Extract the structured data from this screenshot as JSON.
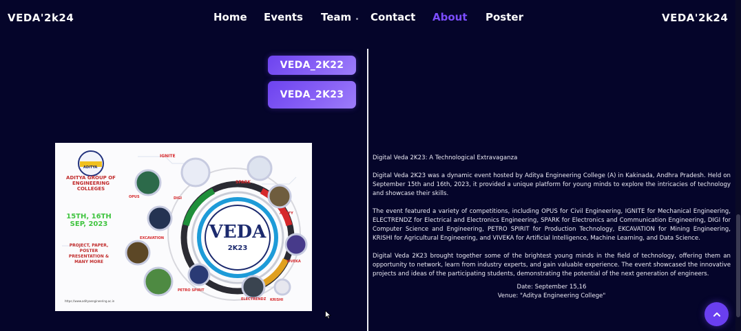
{
  "navbar": {
    "brand_left": "VEDA'2k24",
    "brand_right": "VEDA'2k24",
    "links": [
      {
        "label": "Home",
        "active": false
      },
      {
        "label": "Events",
        "active": false
      },
      {
        "label": "Team",
        "active": false
      },
      {
        "label": "Contact",
        "active": false
      },
      {
        "label": "About",
        "active": true
      },
      {
        "label": "Poster",
        "active": false
      }
    ],
    "active_color": "#7c4dff"
  },
  "year_buttons": [
    "VEDA_2K22",
    "VEDA_2K23"
  ],
  "poster": {
    "college_name": "ADITYA GROUP OF ENGINEERING COLLEGES",
    "logo_text": "ADITYA",
    "dates": "15TH, 16TH SEP, 2023",
    "event_types": "PROJECT, PAPER, POSTER PRESENTATION & MANY MORE",
    "center_title": "VEDA",
    "center_subtitle": "2K23",
    "events": [
      "IGNITE",
      "SPARK",
      "OPUS",
      "DIGI",
      "ARTIFY",
      "EXCAVATION",
      "VIVEKA",
      "PETRO SPIRIT",
      "ELECTRENDZ",
      "KRISHI"
    ],
    "footer_url": "https://www.adityaengineering.ac.in"
  },
  "description": {
    "title": "Digital Veda 2K23: A Technological Extravaganza",
    "para1": "Digital Veda 2K23 was a dynamic event hosted by Aditya Engineering College (A) in Kakinada, Andhra Pradesh. Held on September 15th and 16th, 2023, it provided a unique platform for young minds to explore the intricacies of technology and showcase their skills.",
    "para2": "The event featured a variety of competitions, including OPUS for Civil Engineering, IGNITE for Mechanical Engineering, ELECTRENDZ for Electrical and Electronics Engineering, SPARK for Electronics and Communication Engineering, DIGI for Computer Science and Engineering, PETRO SPIRIT for Production Technology, EKCAVATION for Mining Engineering, KRISHI for Agricultural Engineering, and VIVEKA for Artificial Intelligence, Machine Learning, and Data Science.",
    "para3": "Digital Veda 2K23 brought together some of the brightest young minds in the field of technology, offering them an opportunity to network, learn from industry experts, and gain valuable experience. The event showcased the innovative projects and ideas of the participating students, demonstrating the potential of the next generation of engineers.",
    "date_line": "Date: September 15,16",
    "venue_line": "Venue: \"Aditya Engineering College\""
  },
  "scroll_top": {
    "icon": "chevron-up-icon",
    "color": "#6a3ff0"
  },
  "colors": {
    "background": "#05052a",
    "accent": "#7c4dff"
  }
}
